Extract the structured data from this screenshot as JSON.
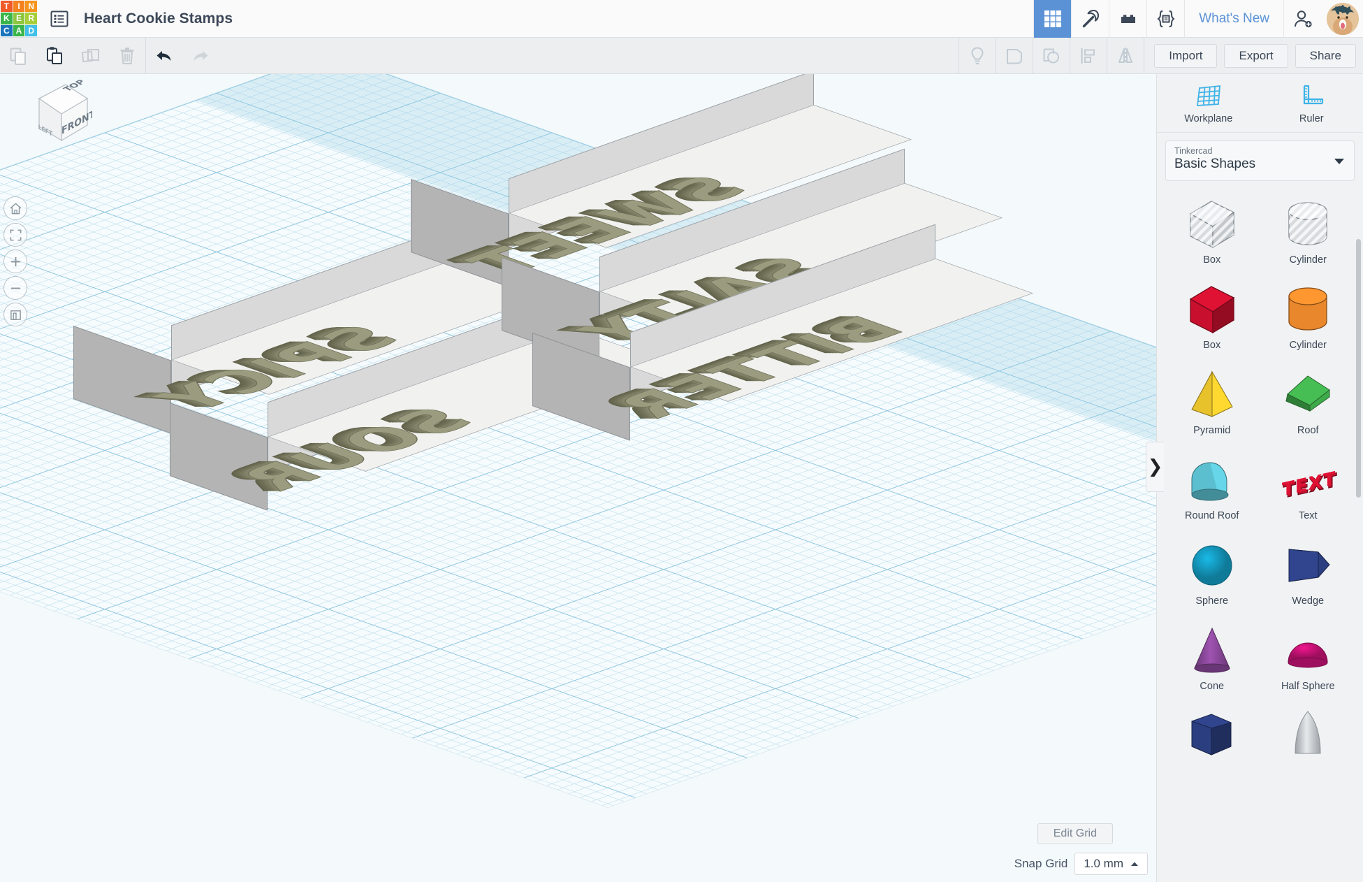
{
  "app": {
    "name": "Tinkercad",
    "logo_tiles": [
      {
        "letter": "T",
        "color": "#f05a28"
      },
      {
        "letter": "I",
        "color": "#f58220"
      },
      {
        "letter": "N",
        "color": "#f7941e"
      },
      {
        "letter": "K",
        "color": "#39b54a"
      },
      {
        "letter": "E",
        "color": "#8dc63f"
      },
      {
        "letter": "R",
        "color": "#a6ce39"
      },
      {
        "letter": "C",
        "color": "#1c75bc"
      },
      {
        "letter": "A",
        "color": "#39b54a"
      },
      {
        "letter": "D",
        "color": "#41bfe8"
      }
    ],
    "accent_blue": "#5b92d6",
    "text_dark": "#3c4858"
  },
  "header": {
    "menu_icon": "list-menu-icon",
    "project_title": "Heart Cookie Stamps",
    "icons": [
      {
        "name": "gallery-grid-icon",
        "active": true
      },
      {
        "name": "pickaxe-icon",
        "active": false
      },
      {
        "name": "lego-brick-icon",
        "active": false
      },
      {
        "name": "codeblocks-icon",
        "active": false
      }
    ],
    "whats_new_label": "What's New",
    "invite_icon": "add-person-icon",
    "avatar": "user-avatar"
  },
  "toolbar": {
    "left_buttons": [
      {
        "name": "copy-button",
        "icon": "copy-icon",
        "enabled": false
      },
      {
        "name": "paste-button",
        "icon": "paste-icon",
        "enabled": true
      },
      {
        "name": "duplicate-button",
        "icon": "duplicate-icon",
        "enabled": false
      },
      {
        "name": "delete-button",
        "icon": "trash-icon",
        "enabled": false
      }
    ],
    "history_buttons": [
      {
        "name": "undo-button",
        "icon": "undo-arrow-icon",
        "enabled": true
      },
      {
        "name": "redo-button",
        "icon": "redo-arrow-icon",
        "enabled": false
      }
    ],
    "right_icon_buttons": [
      {
        "name": "note-button",
        "icon": "lightbulb-icon",
        "enabled": false
      },
      {
        "name": "hole-shape-button",
        "icon": "shape-outline-icon",
        "enabled": false
      },
      {
        "name": "group-button",
        "icon": "group-shapes-icon",
        "enabled": false
      },
      {
        "name": "align-button",
        "icon": "align-icon",
        "enabled": false
      },
      {
        "name": "mirror-button",
        "icon": "mirror-flip-icon",
        "enabled": false
      }
    ],
    "import_label": "Import",
    "export_label": "Export",
    "share_label": "Share"
  },
  "viewport": {
    "view_cube": {
      "name": "view-cube",
      "top_face": "TOP",
      "front_face": "FRONT",
      "left_face": "LEFT"
    },
    "nav_buttons": [
      {
        "name": "home-view-button",
        "icon": "home-icon"
      },
      {
        "name": "fit-to-view-button",
        "icon": "fit-frame-icon"
      },
      {
        "name": "zoom-in-button",
        "icon": "plus-icon"
      },
      {
        "name": "zoom-out-button",
        "icon": "minus-icon"
      },
      {
        "name": "projection-toggle-button",
        "icon": "ortho-perspective-icon"
      }
    ],
    "grid_colors": {
      "background": "#f6fbfd",
      "minor_line": "#bfe0ee",
      "major_line": "#8fc6de"
    },
    "objects": [
      {
        "name": "stamp-spicy",
        "text": "SPICY",
        "mirrored": true,
        "slab_color": "#f1f1ef",
        "text_color": "#9b9c7f"
      },
      {
        "name": "stamp-sour",
        "text": "SOUR",
        "mirrored": true,
        "slab_color": "#f1f1ef",
        "text_color": "#9b9c7f"
      },
      {
        "name": "stamp-sweet",
        "text": "SWEET",
        "mirrored": true,
        "slab_color": "#f1f1ef",
        "text_color": "#9b9c7f"
      },
      {
        "name": "stamp-salty",
        "text": "SALTY",
        "mirrored": true,
        "slab_color": "#f1f1ef",
        "text_color": "#9b9c7f"
      },
      {
        "name": "stamp-bitter",
        "text": "BITTER",
        "mirrored": true,
        "slab_color": "#f1f1ef",
        "text_color": "#9b9c7f"
      }
    ],
    "edit_grid_label": "Edit Grid",
    "snap_grid_label": "Snap Grid",
    "snap_grid_value": "1.0 mm",
    "collapse_handle_glyph": "❯"
  },
  "right_panel": {
    "tools": [
      {
        "name": "workplane-tool",
        "label": "Workplane",
        "icon": "workplane-grid-icon"
      },
      {
        "name": "ruler-tool",
        "label": "Ruler",
        "icon": "ruler-icon"
      }
    ],
    "library_select": {
      "superscript": "Tinkercad",
      "value": "Basic Shapes"
    },
    "shapes": [
      {
        "label": "Box",
        "icon": "hole-box-shape",
        "color": "#c9ced2",
        "kind": "hole-box"
      },
      {
        "label": "Cylinder",
        "icon": "hole-cylinder-shape",
        "color": "#c9ced2",
        "kind": "hole-cylinder"
      },
      {
        "label": "Box",
        "icon": "box-shape",
        "color": "#c8102e",
        "kind": "box"
      },
      {
        "label": "Cylinder",
        "icon": "cylinder-shape",
        "color": "#e8872b",
        "kind": "cylinder"
      },
      {
        "label": "Pyramid",
        "icon": "pyramid-shape",
        "color": "#e8c22b",
        "kind": "pyramid"
      },
      {
        "label": "Roof",
        "icon": "roof-shape",
        "color": "#3faa4a",
        "kind": "roof"
      },
      {
        "label": "Round Roof",
        "icon": "round-roof-shape",
        "color": "#5bbfcf",
        "kind": "roundroof"
      },
      {
        "label": "Text",
        "icon": "text-shape",
        "color": "#c8102e",
        "kind": "text"
      },
      {
        "label": "Sphere",
        "icon": "sphere-shape",
        "color": "#16a6cf",
        "kind": "sphere"
      },
      {
        "label": "Wedge",
        "icon": "wedge-shape",
        "color": "#2b3e7f",
        "kind": "wedge"
      },
      {
        "label": "Cone",
        "icon": "cone-shape",
        "color": "#8e4a9e",
        "kind": "cone"
      },
      {
        "label": "Half Sphere",
        "icon": "half-sphere-shape",
        "color": "#d6147f",
        "kind": "halfsphere"
      },
      {
        "label": "",
        "icon": "polygon-shape",
        "color": "#2b3e7f",
        "kind": "polygon"
      },
      {
        "label": "",
        "icon": "paraboloid-shape",
        "color": "#b9bcc0",
        "kind": "paraboloid"
      }
    ]
  }
}
